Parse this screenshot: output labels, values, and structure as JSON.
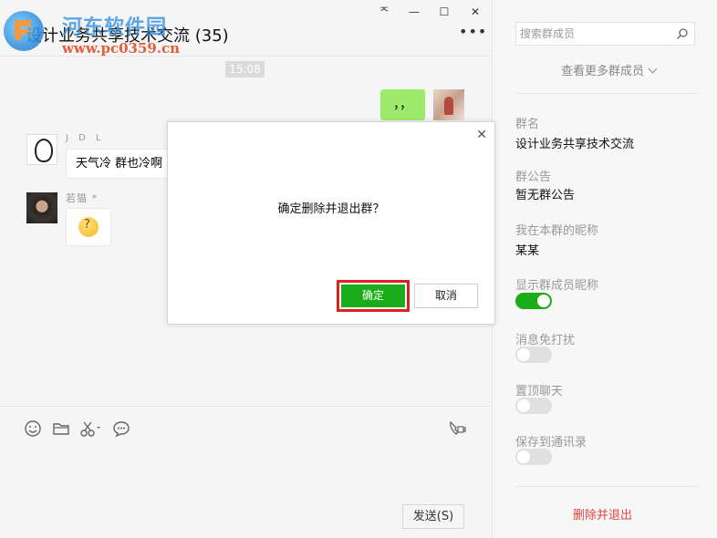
{
  "chat": {
    "title": "设计业务共享技术交流 (35)",
    "time": "15:08",
    "my_message": "，，",
    "messages": [
      {
        "sender": "J D L",
        "text": "天气冷 群也冷啊"
      },
      {
        "sender": "若猫 *",
        "text": ""
      }
    ],
    "send_label": "发送(S)"
  },
  "window": {
    "pin_glyph": "ᅐ",
    "minimize_glyph": "—",
    "maximize_glyph": "☐",
    "close_glyph": "✕",
    "more_glyph": "•••"
  },
  "watermark": {
    "title": "河东软件园",
    "url": "www.pc0359.cn"
  },
  "sidebar": {
    "search_placeholder": "搜索群成员",
    "view_more": "查看更多群成员",
    "group_name_label": "群名",
    "group_name": "设计业务共享技术交流",
    "announcement_label": "群公告",
    "announcement": "暂无群公告",
    "nickname_label": "我在本群的昵称",
    "nickname": "某某",
    "show_nickname_label": "显示群成员昵称",
    "show_nickname_on": true,
    "mute_label": "消息免打扰",
    "mute_on": false,
    "pin_label": "置顶聊天",
    "pin_on": false,
    "save_label": "保存到通讯录",
    "save_on": false,
    "delete_exit": "删除并退出"
  },
  "dialog": {
    "close_glyph": "✕",
    "message": "确定删除并退出群？",
    "ok_label": "确定",
    "cancel_label": "取消"
  },
  "colors": {
    "accent_green": "#1aad19",
    "bubble_green": "#9eea6a",
    "danger_red": "#e64340",
    "highlight_red": "#e01f1f"
  }
}
